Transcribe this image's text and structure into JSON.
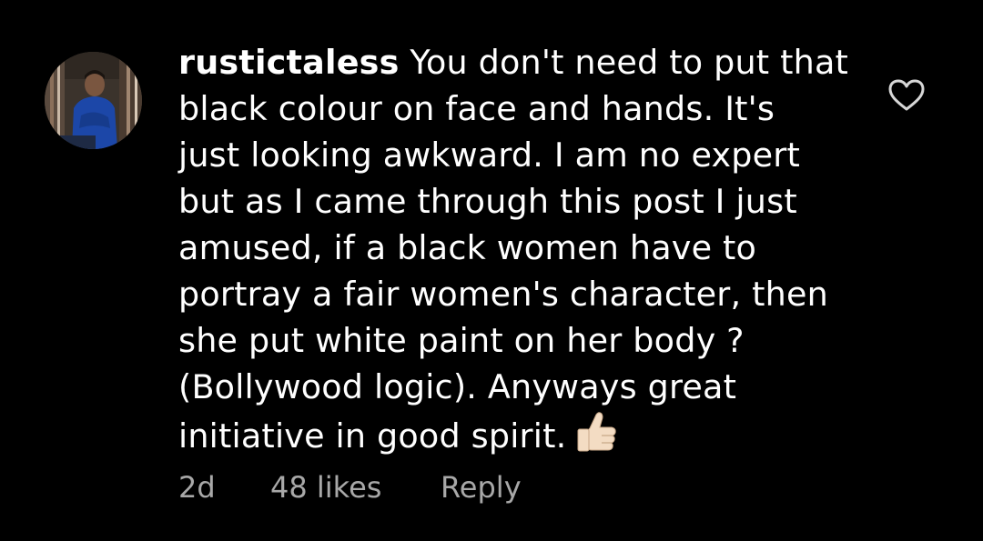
{
  "comment": {
    "username": "rustictaless",
    "text_lines": [
      "You don't need to put that",
      "black colour on face and hands. It's",
      "just looking awkward. I am no expert",
      "but as I came through this post I just",
      "amused, if a black women have to",
      "portray a fair women's character, then",
      "she put white paint on her body ?",
      "(Bollywood logic). Anyways great",
      "initiative in good spirit."
    ],
    "emoji": "thumbs-up",
    "meta": {
      "time": "2d",
      "likes": "48 likes",
      "reply_label": "Reply"
    }
  },
  "icons": {
    "like": "heart-outline-icon",
    "avatar": "user-avatar-photo"
  },
  "colors": {
    "background": "#000000",
    "text": "#ffffff",
    "meta_text": "#a8a8a8"
  }
}
